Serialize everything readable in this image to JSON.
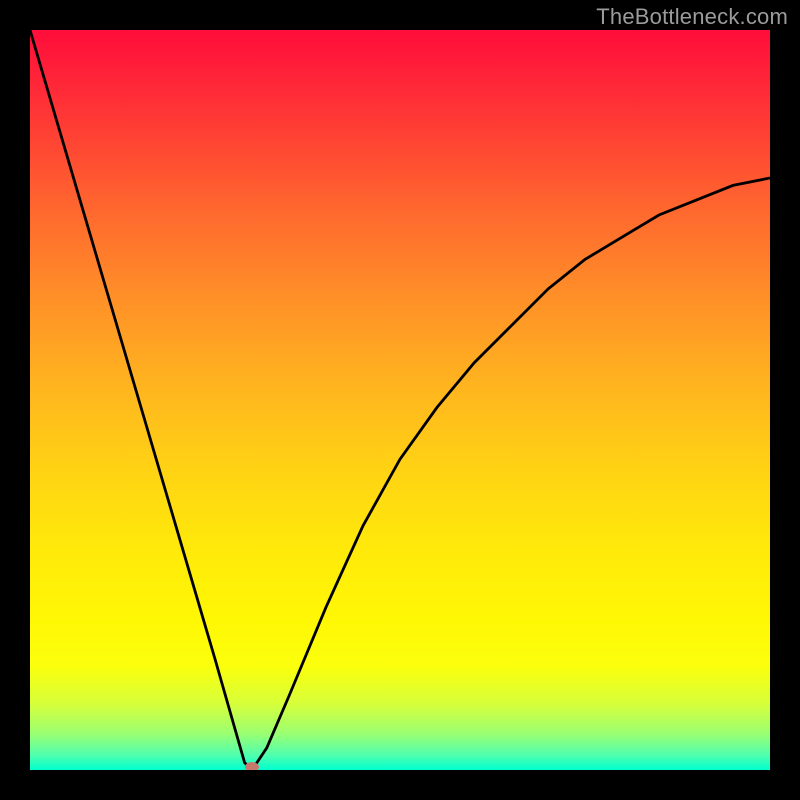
{
  "watermark": "TheBottleneck.com",
  "chart_data": {
    "type": "line",
    "title": "",
    "xlabel": "",
    "ylabel": "",
    "xlim": [
      0,
      100
    ],
    "ylim": [
      0,
      100
    ],
    "grid": false,
    "legend": false,
    "series": [
      {
        "name": "bottleneck-curve",
        "x": [
          0,
          5,
          10,
          15,
          20,
          25,
          29,
          30,
          32,
          35,
          40,
          45,
          50,
          55,
          60,
          65,
          70,
          75,
          80,
          85,
          90,
          95,
          100
        ],
        "y": [
          100,
          83,
          66,
          49,
          32,
          15,
          1,
          0,
          3,
          10,
          22,
          33,
          42,
          49,
          55,
          60,
          65,
          69,
          72,
          75,
          77,
          79,
          80
        ]
      }
    ],
    "marker": {
      "x": 30,
      "y": 0,
      "label": "optimal-point"
    },
    "background_gradient": {
      "stops": [
        {
          "pos": 0.0,
          "color": "#ff0d3a"
        },
        {
          "pos": 0.5,
          "color": "#ffb41f"
        },
        {
          "pos": 0.8,
          "color": "#fff805"
        },
        {
          "pos": 1.0,
          "color": "#00ffd0"
        }
      ]
    }
  }
}
